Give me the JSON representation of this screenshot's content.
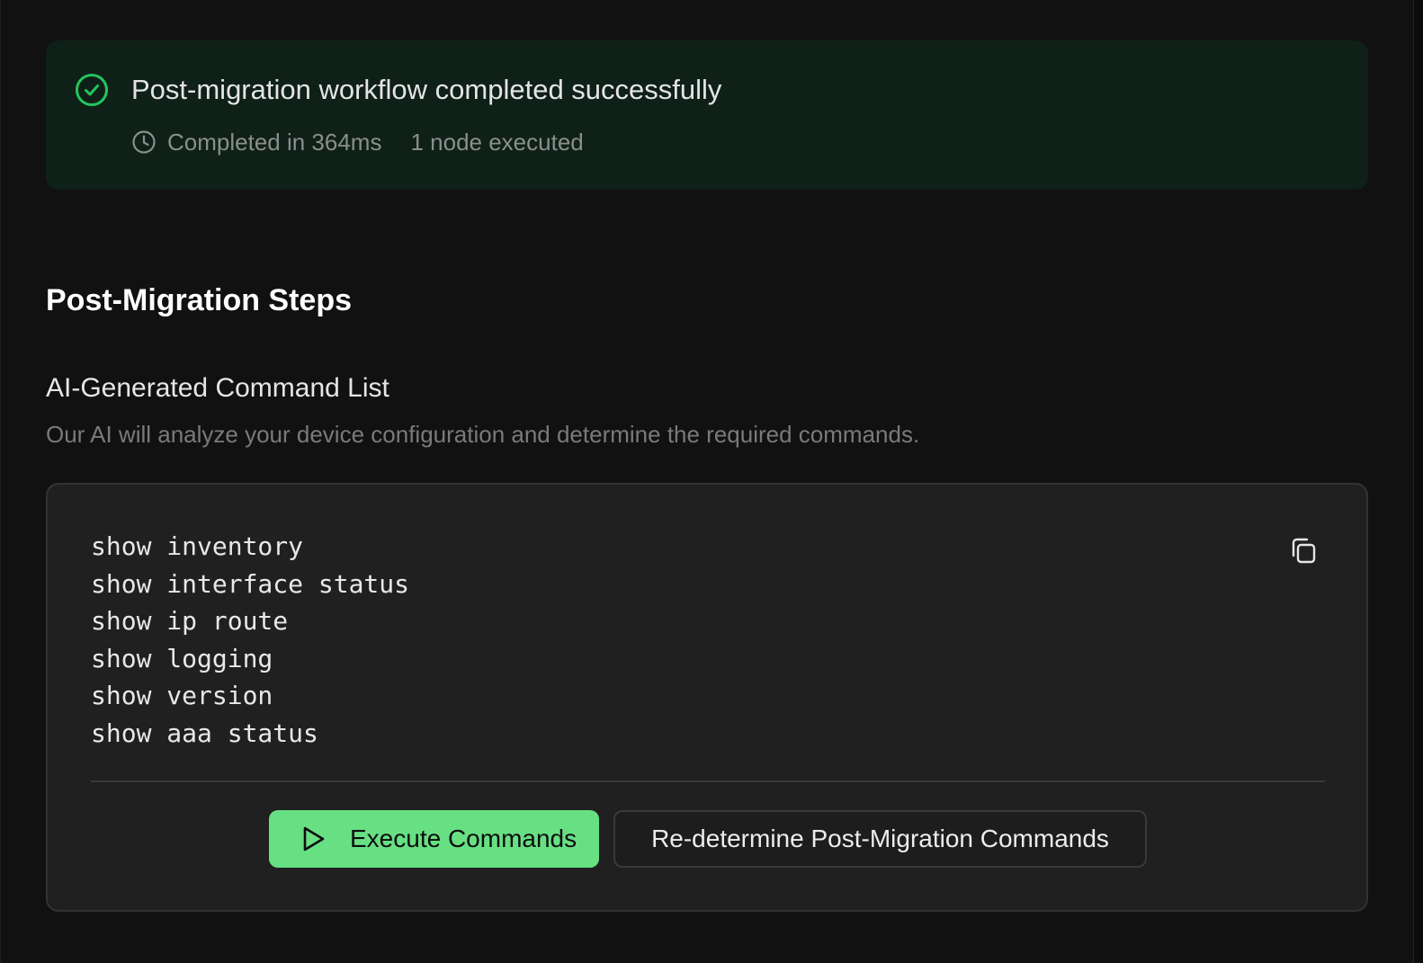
{
  "status_banner": {
    "title": "Post-migration workflow completed successfully",
    "duration": "Completed in 364ms",
    "nodes": "1 node executed",
    "icon": "check-circle-icon",
    "accent_color": "#22c55e"
  },
  "section": {
    "title": "Post-Migration Steps",
    "subtitle": "AI-Generated Command List",
    "description": "Our AI will analyze your device configuration and determine the required commands."
  },
  "commands": [
    "show inventory",
    "show interface status",
    "show ip route",
    "show logging",
    "show version",
    "show aaa status"
  ],
  "actions": {
    "execute_label": "Execute Commands",
    "execute_icon": "play-icon",
    "execute_color": "#67e083",
    "redetermine_label": "Re-determine Post-Migration Commands",
    "copy_icon": "copy-icon"
  }
}
